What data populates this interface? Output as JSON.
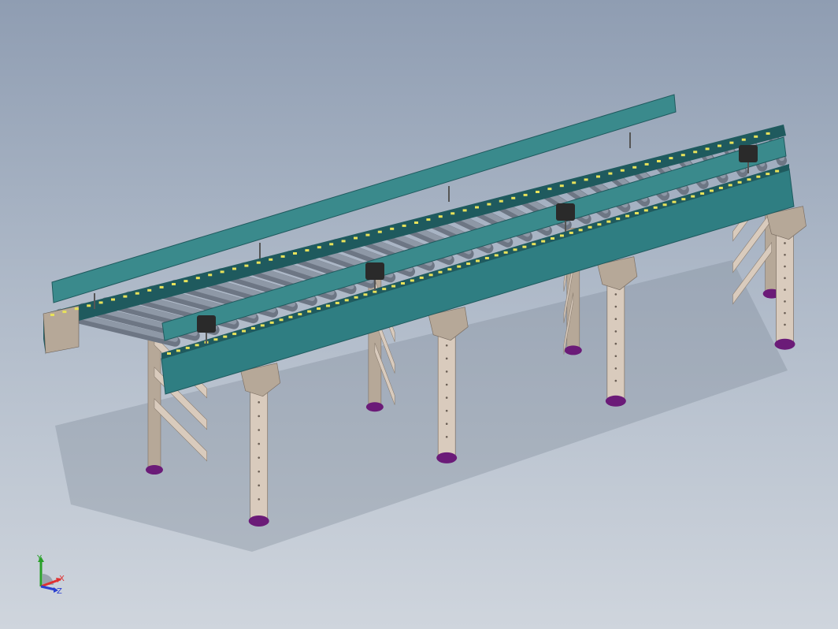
{
  "viewport": {
    "background_top": "#8f9db2",
    "background_bottom": "#cfd5dd"
  },
  "model": {
    "subject": "roller conveyor",
    "colors": {
      "side_frame": "#2f7e82",
      "side_frame_dark": "#1f5a5e",
      "guide_rail": "#3a8a8c",
      "roller": "#8e98a6",
      "roller_dark": "#6d7684",
      "leg": "#d9cbbd",
      "leg_dark": "#b6a898",
      "foot": "#6b1b78",
      "chain_mark": "#e8e25a",
      "bracket": "#2a2a2a"
    }
  },
  "triad": {
    "icon": "coordinate-triad-icon",
    "x_label": "X",
    "y_label": "Y",
    "z_label": "Z",
    "x_color": "#e03030",
    "y_color": "#2aa02a",
    "z_color": "#2a3fd0"
  }
}
